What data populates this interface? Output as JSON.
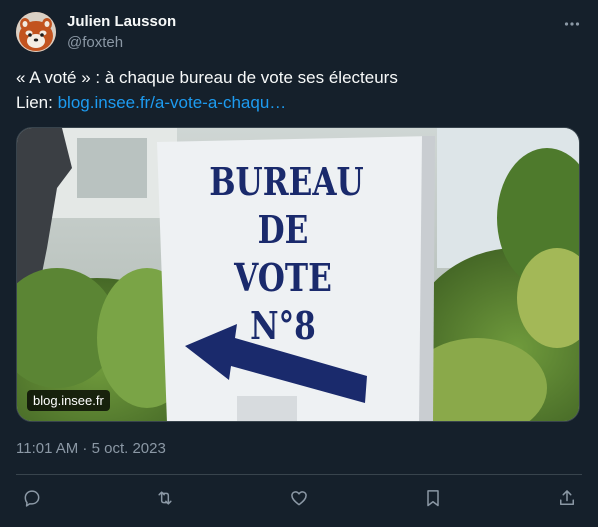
{
  "author": {
    "name": "Julien Lausson",
    "handle": "@foxteh",
    "avatar_icon": "red-panda-avatar"
  },
  "tweet": {
    "text_line1": "« A voté » : à chaque bureau de vote ses électeurs",
    "link_prefix": "Lien: ",
    "link_text": "blog.insee.fr/a-vote-a-chaqu…",
    "timestamp": "11:01 AM · 5 oct. 2023"
  },
  "media": {
    "sign_lines": [
      "BUREAU",
      "DE VOTE",
      "N°8"
    ],
    "source_badge": "blog.insee.fr"
  },
  "actions": [
    "reply-icon",
    "retweet-icon",
    "like-icon",
    "bookmark-icon",
    "share-icon"
  ],
  "colors": {
    "background": "#15202b",
    "text": "#f7f9f9",
    "secondary": "#8b98a5",
    "link": "#1d9bf0",
    "sign_ink": "#1a2a6c"
  }
}
